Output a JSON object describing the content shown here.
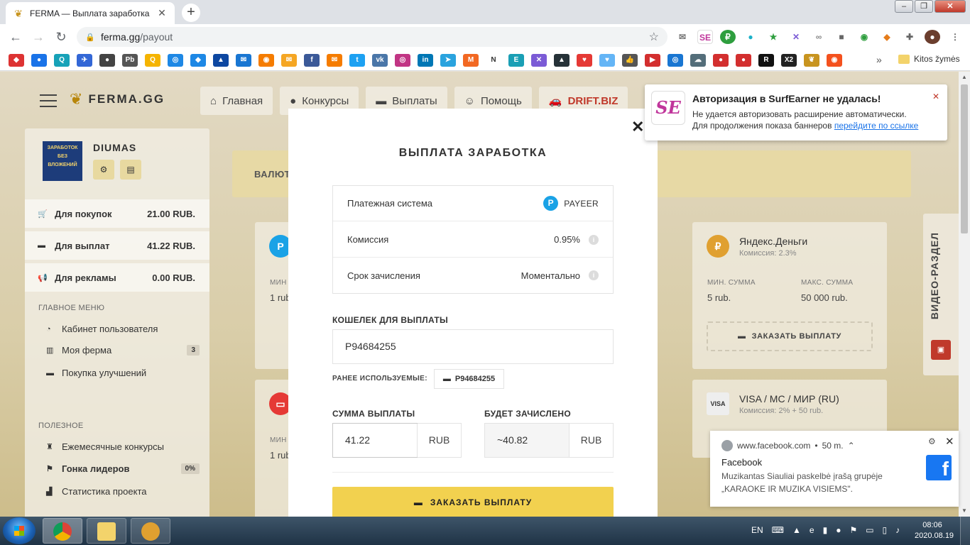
{
  "browser": {
    "tab_title": "FERMA — Выплата заработка",
    "url_host": "ferma.gg",
    "url_path": "/payout",
    "bookmarks_folder": "Kitos žymės",
    "extension_letters": [
      "N",
      "R",
      "X2"
    ]
  },
  "site": {
    "logo_text": "FERMA.GG",
    "nav": [
      {
        "label": "Главная",
        "icon": "home-icon"
      },
      {
        "label": "Конкурсы",
        "icon": "trophy-icon"
      },
      {
        "label": "Выплаты",
        "icon": "wallet-icon"
      },
      {
        "label": "Помощь",
        "icon": "support-icon"
      },
      {
        "label": "DRIFT.BIZ",
        "icon": "car-icon"
      }
    ]
  },
  "sidebar": {
    "avatar_text": "ЗАРАБОТОК БЕЗ ВЛОЖЕНИЙ",
    "username": "DIUMAS",
    "balances": [
      {
        "label": "Для покупок",
        "value": "21.00 RUB.",
        "icon": "cart-icon"
      },
      {
        "label": "Для выплат",
        "value": "41.22 RUB.",
        "icon": "wallet-icon"
      },
      {
        "label": "Для рекламы",
        "value": "0.00 RUB.",
        "icon": "megaphone-icon"
      }
    ],
    "main_menu_title": "ГЛАВНОЕ МЕНЮ",
    "main_menu": [
      {
        "label": "Кабинет пользователя",
        "badge": ""
      },
      {
        "label": "Моя ферма",
        "badge": "3"
      },
      {
        "label": "Покупка улучшений",
        "badge": ""
      }
    ],
    "useful_title": "ПОЛЕЗНОЕ",
    "useful": [
      {
        "label": "Ежемесячные конкурсы",
        "badge": ""
      },
      {
        "label": "Гонка лидеров",
        "badge": "0%"
      },
      {
        "label": "Статистика проекта",
        "badge": ""
      }
    ]
  },
  "background": {
    "valuta_label": "ВАЛЮТ",
    "partial_min_label": "МИН",
    "partial_min_value": "1 rub",
    "yandex": {
      "name": "Яндекс.Деньги",
      "commission": "Комиссия: 2.3%",
      "min_label": "МИН. СУММА",
      "min_value": "5 rub.",
      "max_label": "МАКС. СУММА",
      "max_value": "50 000 rub.",
      "button": "ЗАКАЗАТЬ ВЫПЛАТУ"
    },
    "visa": {
      "name": "VISA / MC / МИР (RU)",
      "commission": "Комиссия: 2% + 50 rub."
    },
    "video_tab": "ВИДЕО-РАЗДЕЛ"
  },
  "modal": {
    "title": "ВЫПЛАТА ЗАРАБОТКА",
    "rows": [
      {
        "label": "Платежная система",
        "value": "PAYEER"
      },
      {
        "label": "Комиссия",
        "value": "0.95%"
      },
      {
        "label": "Срок зачисления",
        "value": "Моментально"
      }
    ],
    "wallet_label": "КОШЕЛЕК ДЛЯ ВЫПЛАТЫ",
    "wallet_value": "P94684255",
    "prev_label": "РАНЕЕ ИСПОЛЬЗУЕМЫЕ:",
    "prev_wallet": "P94684255",
    "amount_label": "СУММА ВЫПЛАТЫ",
    "amount_value": "41.22",
    "amount_currency": "RUB",
    "credited_label": "БУДЕТ ЗАЧИСЛЕНО",
    "credited_value": "~40.82",
    "credited_currency": "RUB",
    "submit_label": "ЗАКАЗАТЬ ВЫПЛАТУ"
  },
  "surfearner": {
    "title": "Авторизация в SurfEarner не удалась!",
    "line1": "Не удается авторизовать расширение автоматически.",
    "line2": "Для продолжения показа баннеров",
    "link": "перейдите по ссылке"
  },
  "facebook_notification": {
    "source": "www.facebook.com",
    "time": "50 m.",
    "title": "Facebook",
    "line1": "Muzikantas Siauliai paskelbė įrašą grupėje",
    "line2": "„KARAOKE IR MUZIKA VISIEMS\"."
  },
  "taskbar": {
    "lang": "EN",
    "time": "08:06",
    "date": "2020.08.19"
  }
}
